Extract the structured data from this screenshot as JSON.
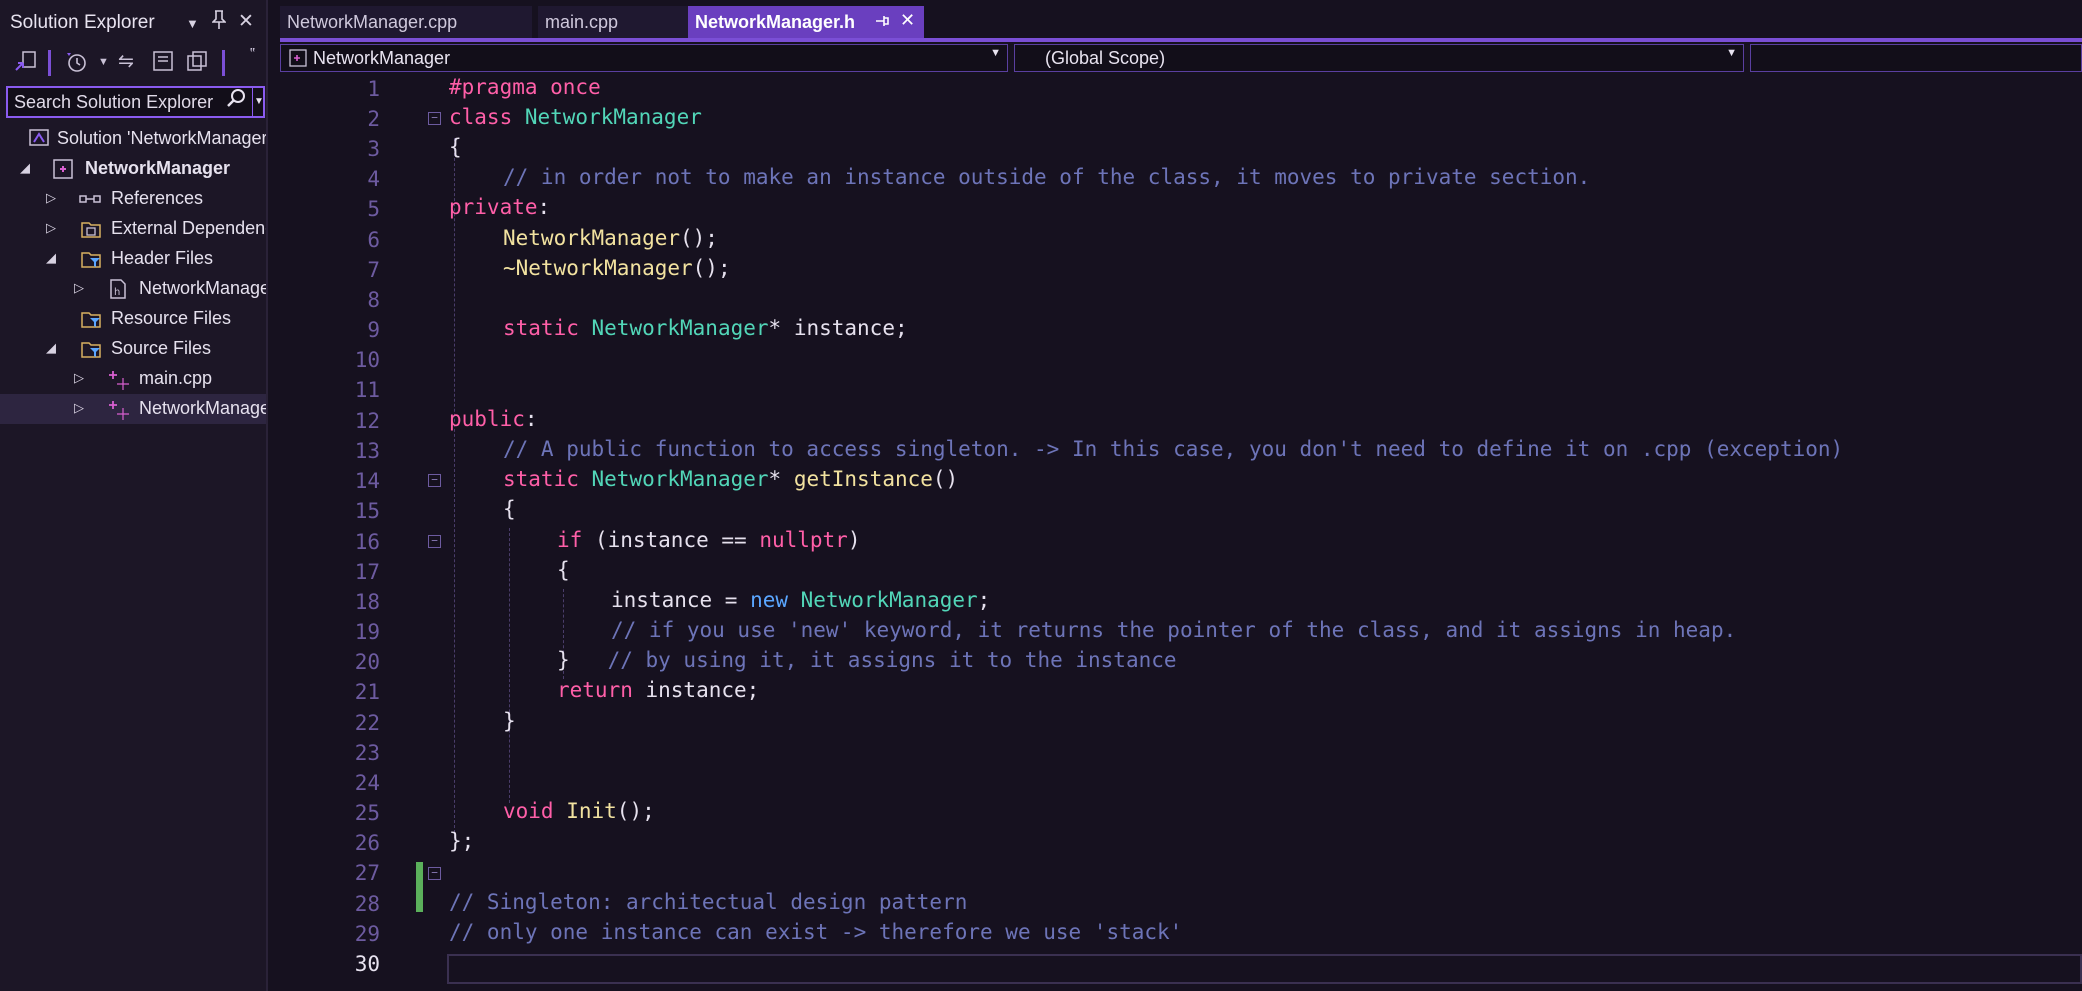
{
  "solution_explorer": {
    "title": "Solution Explorer",
    "search_placeholder": "Search Solution Explorer",
    "tree": [
      {
        "label": "Solution 'NetworkManager"
      },
      {
        "label": "NetworkManager"
      },
      {
        "label": "References"
      },
      {
        "label": "External Dependencies"
      },
      {
        "label": "Header Files"
      },
      {
        "label": "NetworkManager.h"
      },
      {
        "label": "Resource Files"
      },
      {
        "label": "Source Files"
      },
      {
        "label": "main.cpp"
      },
      {
        "label": "NetworkManager.cpp"
      }
    ]
  },
  "tabs": [
    {
      "label": "NetworkManager.cpp"
    },
    {
      "label": "main.cpp"
    },
    {
      "label": "NetworkManager.h"
    }
  ],
  "navbar": {
    "project": "NetworkManager",
    "scope": "(Global Scope)"
  },
  "editor": {
    "current_line": 30,
    "line_numbers": [
      "1",
      "2",
      "3",
      "4",
      "5",
      "6",
      "7",
      "8",
      "9",
      "10",
      "11",
      "12",
      "13",
      "14",
      "15",
      "16",
      "17",
      "18",
      "19",
      "20",
      "21",
      "22",
      "23",
      "24",
      "25",
      "26",
      "27",
      "28",
      "29",
      "30"
    ],
    "tokens": {
      "l1": "#pragma once",
      "l2_kw": "class ",
      "l2_ty": "NetworkManager",
      "l3": "{",
      "l4": "// in order not to make an instance outside of the class, it moves to private section.",
      "l5_kw": "private",
      "l5_p": ":",
      "l6_fn": "NetworkManager",
      "l6_p": "();",
      "l7_fn": "~NetworkManager",
      "l7_p": "();",
      "l9_kw": "static ",
      "l9_ty": "NetworkManager",
      "l9_p": "* instance;",
      "l12_kw": "public",
      "l12_p": ":",
      "l13": "// A public function to access singleton. -> In this case, you don't need to define it on .cpp (exception)",
      "l14_kw": "static ",
      "l14_ty": "NetworkManager",
      "l14_p": "* ",
      "l14_fn": "getInstance",
      "l14_p2": "()",
      "l15": "{",
      "l16_kw": "if",
      "l16_p": " (instance == ",
      "l16_kw2": "nullptr",
      "l16_p2": ")",
      "l17": "{",
      "l18_p": "instance = ",
      "l18_new": "new ",
      "l18_ty": "NetworkManager",
      "l18_p2": ";",
      "l19": "// if you use 'new' keyword, it returns the pointer of the class, and it assigns in heap.",
      "l20_p": "}   ",
      "l20_c": "// by using it, it assigns it to the instance",
      "l21_kw": "return",
      "l21_p": " instance;",
      "l22": "}",
      "l24_kw": "void ",
      "l24_fn": "Init",
      "l24_p": "();",
      "l25": "};",
      "l27": "// Singleton: architectual design pattern",
      "l28": "// only one instance can exist -> therefore we use 'stack'"
    }
  },
  "colors": {
    "accent": "#7b4fd6",
    "background": "#16111f",
    "keyword": "#ff5fa8",
    "type": "#52d6b8",
    "function": "#f2e2a0",
    "comment": "#6d74b8"
  }
}
